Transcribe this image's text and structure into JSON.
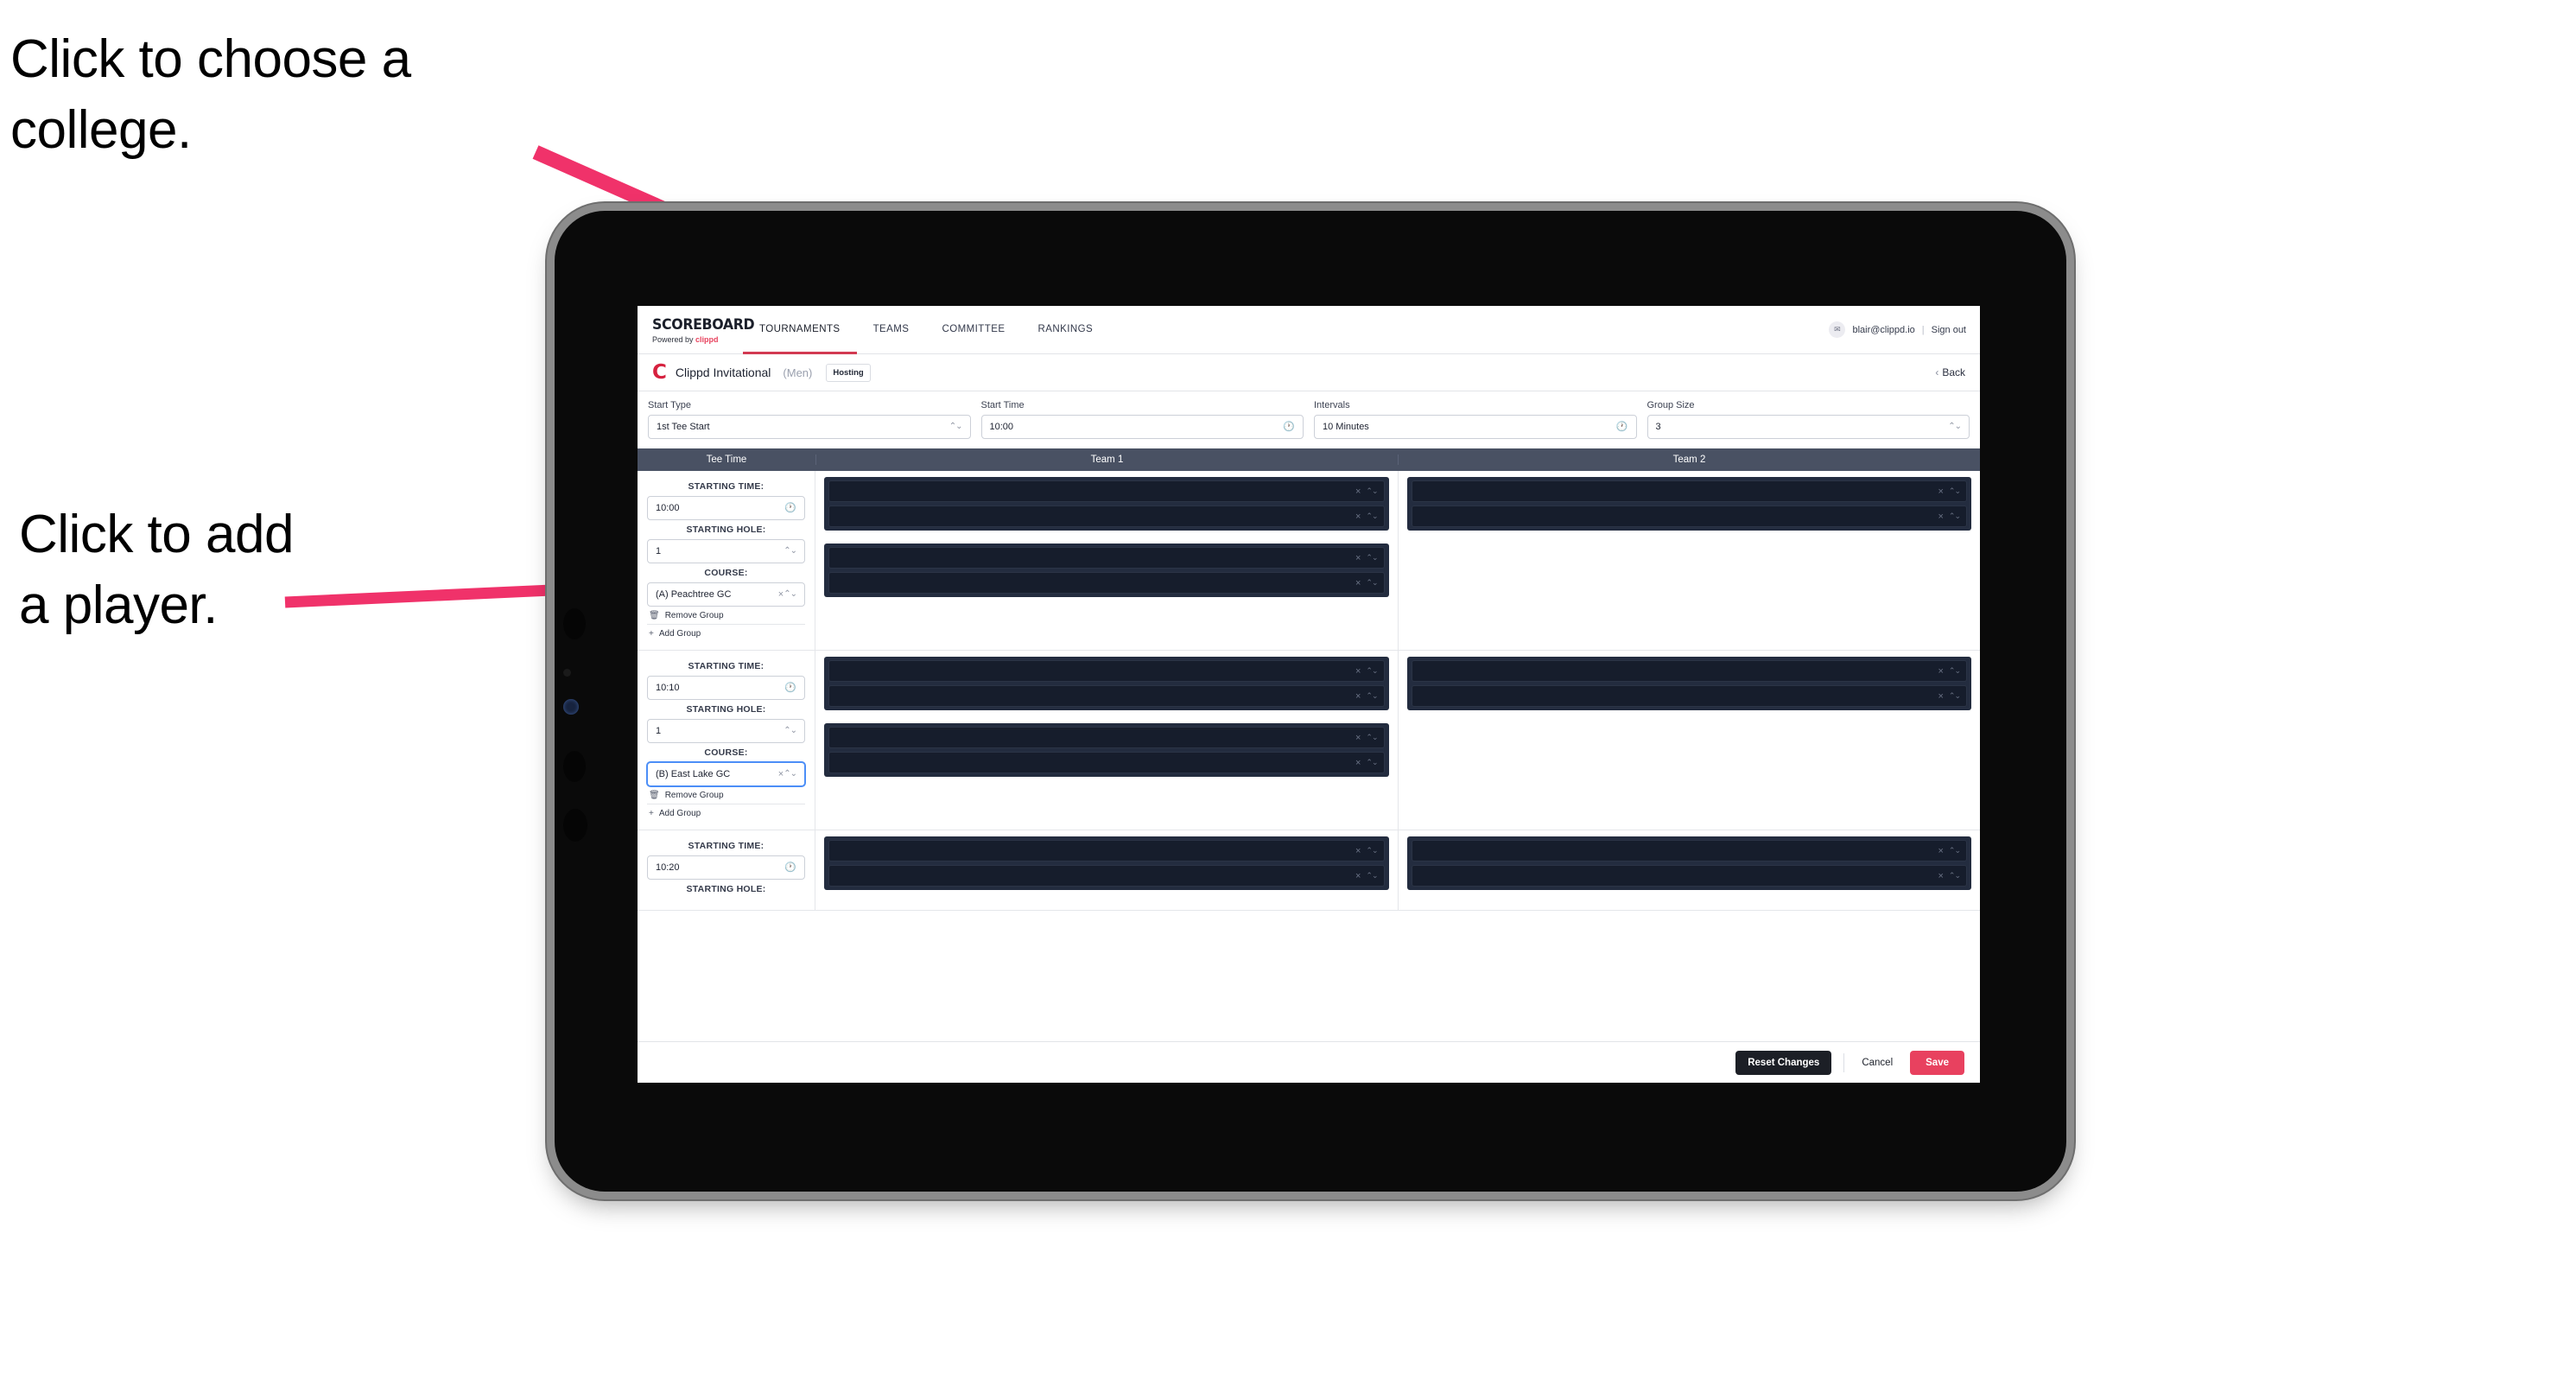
{
  "annotations": [
    {
      "id": "choose-college",
      "text": "Click to choose a\ncollege."
    },
    {
      "id": "add-player",
      "text": "Click to add\na player."
    }
  ],
  "annotation_color": "#f0326a",
  "app": {
    "brand": {
      "title": "SCOREBOARD",
      "powered_prefix": "Powered by ",
      "powered_name": "clippd"
    },
    "nav_tabs": [
      {
        "label": "TOURNAMENTS",
        "active": true
      },
      {
        "label": "TEAMS",
        "active": false
      },
      {
        "label": "COMMITTEE",
        "active": false
      },
      {
        "label": "RANKINGS",
        "active": false
      }
    ],
    "account": {
      "avatar_glyph": "✉",
      "email": "blair@clippd.io",
      "separator": "|",
      "sign_out": "Sign out"
    },
    "subheader": {
      "logo_letter": "C",
      "tournament_name": "Clippd Invitational",
      "gender": "(Men)",
      "badge": "Hosting",
      "back_chevron": "‹",
      "back_label": "Back"
    },
    "settings": [
      {
        "label": "Start Type",
        "value": "1st Tee Start",
        "icon": "stepper-icon"
      },
      {
        "label": "Start Time",
        "value": "10:00",
        "icon": "clock-icon"
      },
      {
        "label": "Intervals",
        "value": "10 Minutes",
        "icon": "clock-icon"
      },
      {
        "label": "Group Size",
        "value": "3",
        "icon": "stepper-icon"
      }
    ],
    "table_headers": {
      "tee_time": "Tee Time",
      "team1": "Team 1",
      "team2": "Team 2"
    },
    "row_labels": {
      "starting_time": "STARTING TIME:",
      "starting_hole": "STARTING HOLE:",
      "course": "COURSE:"
    },
    "group_actions": {
      "remove": "Remove Group",
      "remove_icon": "trash-icon",
      "add": "Add Group",
      "add_icon": "plus-icon"
    },
    "slot_icons": {
      "clear": "×",
      "stepper": "⌃⌄"
    },
    "groups": [
      {
        "starting_time": "10:00",
        "starting_hole": "1",
        "course": "(A) Peachtree GC",
        "course_focused": false,
        "team1_boxes": [
          {
            "slots": 2
          },
          {
            "slots": 2
          }
        ],
        "team2_boxes": [
          {
            "slots": 2
          }
        ]
      },
      {
        "starting_time": "10:10",
        "starting_hole": "1",
        "course": "(B) East Lake GC",
        "course_focused": true,
        "team1_boxes": [
          {
            "slots": 2
          },
          {
            "slots": 2
          }
        ],
        "team2_boxes": [
          {
            "slots": 2
          }
        ]
      },
      {
        "starting_time": "10:20",
        "starting_hole": "",
        "course": "",
        "course_focused": false,
        "team1_boxes": [
          {
            "slots": 2
          }
        ],
        "team2_boxes": [
          {
            "slots": 2
          }
        ]
      }
    ],
    "footer": {
      "reset": "Reset Changes",
      "cancel": "Cancel",
      "save": "Save",
      "save_color": "#e8415f"
    }
  }
}
